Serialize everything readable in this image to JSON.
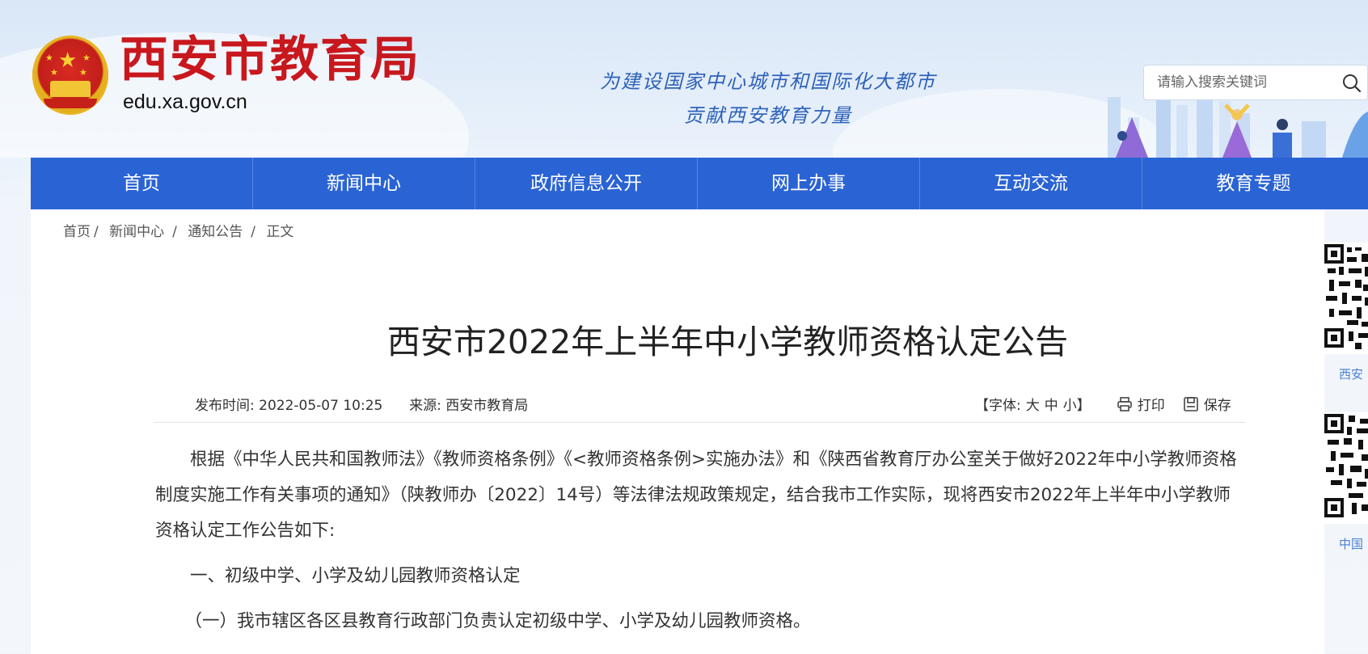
{
  "header": {
    "site_title": "西安市教育局",
    "site_domain": "edu.xa.gov.cn",
    "slogan_line1": "为建设国家中心城市和国际化大都市",
    "slogan_line2": "贡献西安教育力量",
    "search": {
      "placeholder": "请输入搜索关键词"
    }
  },
  "nav": {
    "items": [
      {
        "label": "首页"
      },
      {
        "label": "新闻中心"
      },
      {
        "label": "政府信息公开"
      },
      {
        "label": "网上办事"
      },
      {
        "label": "互动交流"
      },
      {
        "label": "教育专题"
      }
    ]
  },
  "breadcrumb": {
    "items": [
      "首页",
      "新闻中心",
      "通知公告",
      "正文"
    ],
    "separator": "/"
  },
  "article": {
    "title": "西安市2022年上半年中小学教师资格认定公告",
    "publish_label": "发布时间: ",
    "publish_time": "2022-05-07 10:25",
    "source_label": "来源: ",
    "source": "西安市教育局",
    "font_label": "【字体:",
    "font_large": "大",
    "font_medium": "中",
    "font_small": "小",
    "font_end": "】",
    "print_label": "打印",
    "save_label": "保存",
    "paragraphs": [
      "根据《中华人民共和国教师法》《教师资格条例》《<教师资格条例>实施办法》和《陕西省教育厅办公室关于做好2022年中小学教师资格制度实施工作有关事项的通知》（陕教师办〔2022〕14号）等法律法规政策规定，结合我市工作实际，现将西安市2022年上半年中小学教师资格认定工作公告如下:",
      "一、初级中学、小学及幼儿园教师资格认定",
      "（一）我市辖区各区县教育行政部门负责认定初级中学、小学及幼儿园教师资格。"
    ]
  },
  "side_panel": {
    "qr1_caption": "西安",
    "qr2_caption": "中国"
  },
  "colors": {
    "nav_bg": "#2a63d4",
    "title_red": "#c8181e",
    "slogan_blue": "#2f62b9"
  }
}
